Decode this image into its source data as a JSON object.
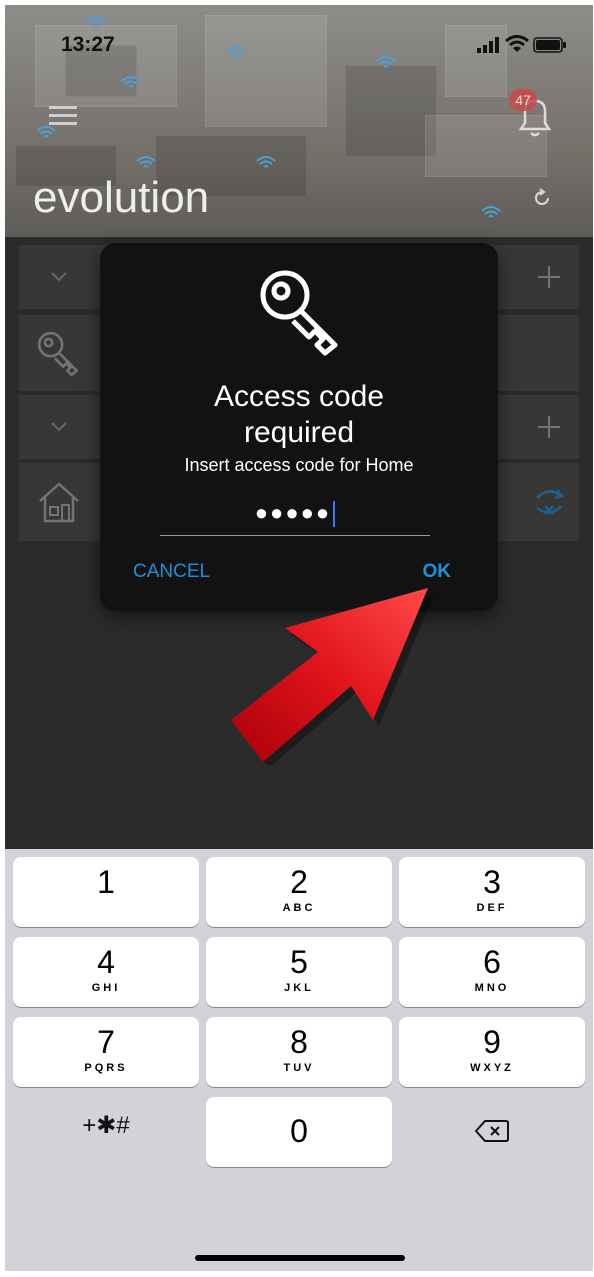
{
  "status_bar": {
    "time": "13:27"
  },
  "header": {
    "title": "evolution",
    "notification_count": "47"
  },
  "dialog": {
    "icon": "key-icon",
    "title_line1": "Access code",
    "title_line2": "required",
    "subtitle": "Insert access code for Home",
    "input_value": "●●●●●",
    "cancel_label": "CANCEL",
    "ok_label": "OK"
  },
  "keypad": {
    "keys": [
      {
        "digit": "1",
        "letters": ""
      },
      {
        "digit": "2",
        "letters": "ABC"
      },
      {
        "digit": "3",
        "letters": "DEF"
      },
      {
        "digit": "4",
        "letters": "GHI"
      },
      {
        "digit": "5",
        "letters": "JKL"
      },
      {
        "digit": "6",
        "letters": "MNO"
      },
      {
        "digit": "7",
        "letters": "PQRS"
      },
      {
        "digit": "8",
        "letters": "TUV"
      },
      {
        "digit": "9",
        "letters": "WXYZ"
      },
      {
        "digit": "0",
        "letters": ""
      }
    ],
    "symbols_label": "+✱#",
    "delete_icon": "backspace-icon"
  },
  "colors": {
    "accent": "#1e8fd8",
    "dialog_bg": "#121212",
    "keypad_bg": "#d1d3d9",
    "arrow": "#e0141b"
  }
}
